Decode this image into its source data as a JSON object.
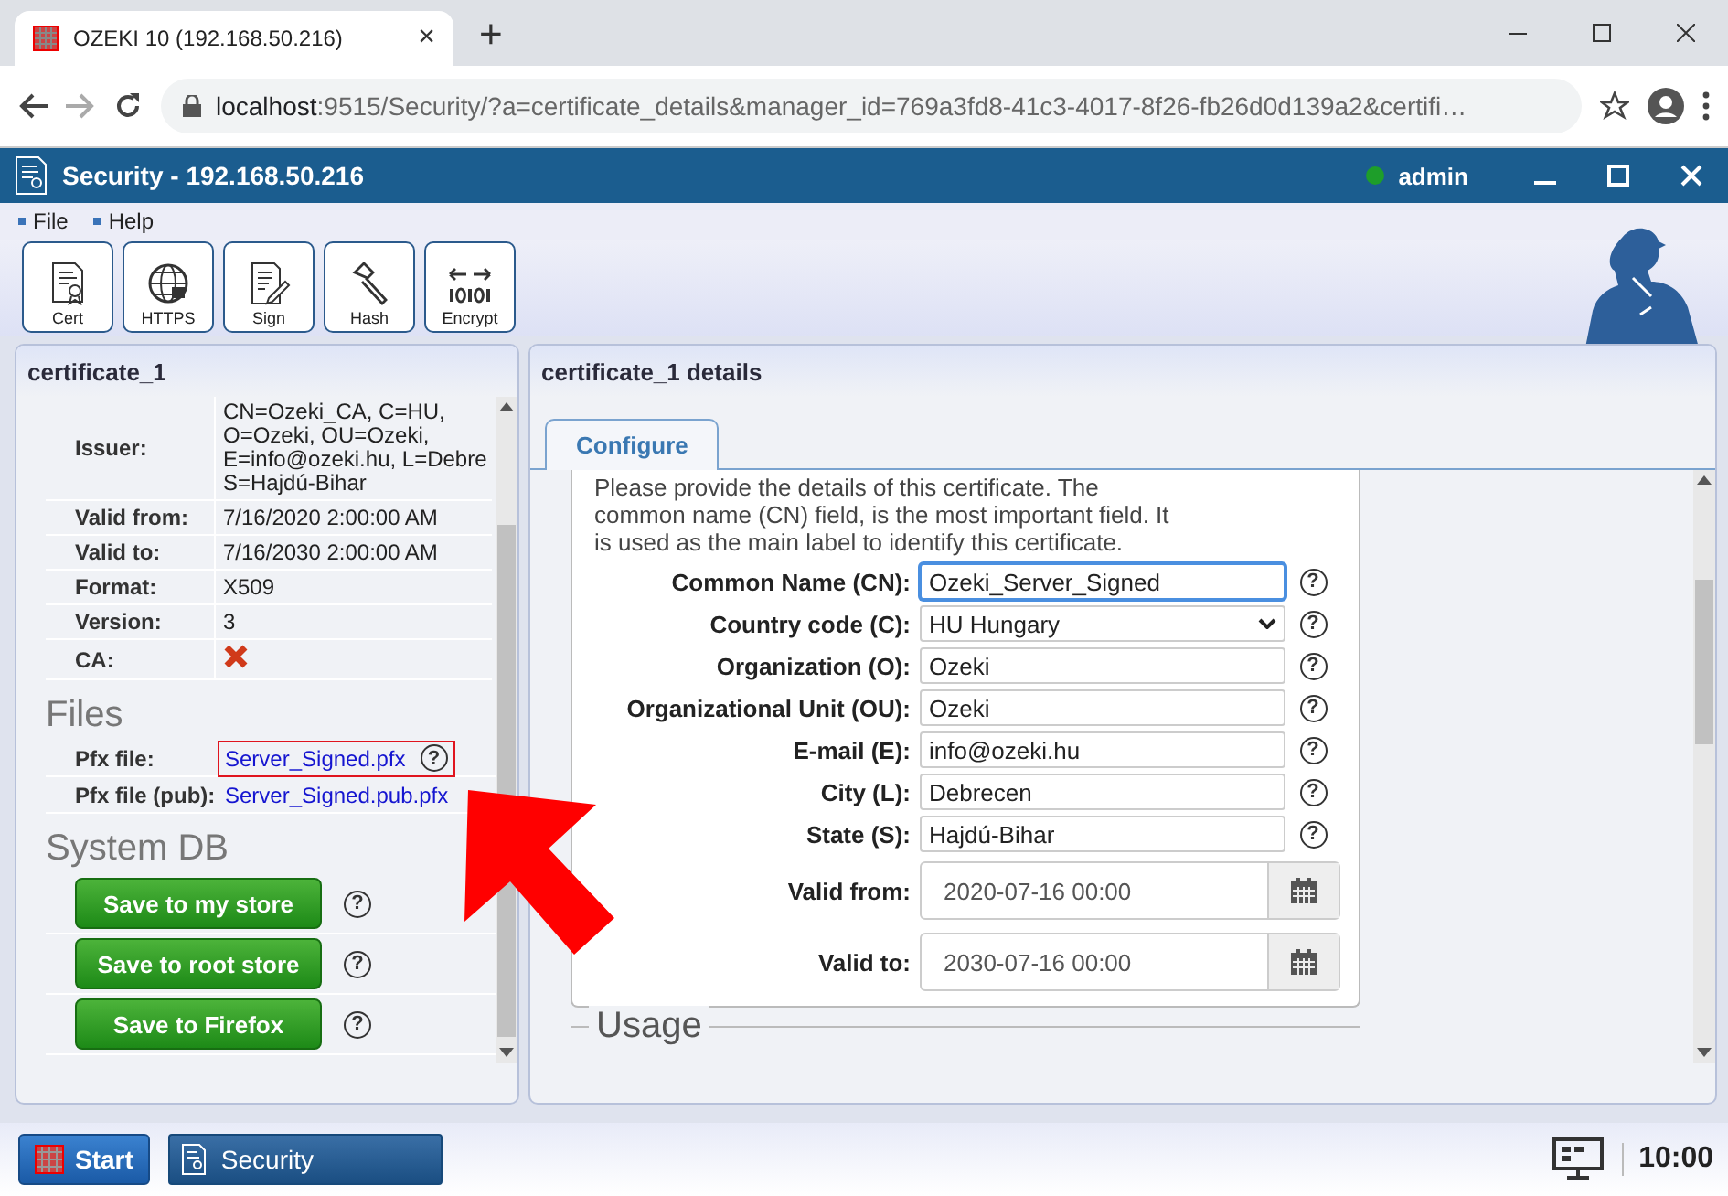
{
  "browser": {
    "tab_title": "OZEKI 10 (192.168.50.216)",
    "tab_close": "×",
    "new_tab": "+",
    "url_host": "localhost",
    "url_rest": ":9515/Security/?a=certificate_details&manager_id=769a3fd8-41c3-4017-8f26-fb26d0d139a2&certifi…"
  },
  "app": {
    "title": "Security - 192.168.50.216",
    "user": "admin",
    "online": true
  },
  "menu": [
    "File",
    "Help"
  ],
  "toolbar": [
    {
      "label": "Cert",
      "kind": "cert"
    },
    {
      "label": "HTTPS",
      "kind": "https"
    },
    {
      "label": "Sign",
      "kind": "sign"
    },
    {
      "label": "Hash",
      "kind": "hash"
    },
    {
      "label": "Encrypt",
      "kind": "encrypt"
    }
  ],
  "left_panel": {
    "title": "certificate_1",
    "properties": [
      {
        "label": "Issuer:",
        "kind": "text",
        "lines": [
          "CN=Ozeki_CA, C=HU,",
          "O=Ozeki, OU=Ozeki,",
          "E=info@ozeki.hu, L=Debre",
          "S=Hajdú-Bihar"
        ]
      },
      {
        "label": "Valid from:",
        "kind": "text",
        "lines": [
          "7/16/2020 2:00:00 AM"
        ]
      },
      {
        "label": "Valid to:",
        "kind": "text",
        "lines": [
          "7/16/2030 2:00:00 AM"
        ]
      },
      {
        "label": "Format:",
        "kind": "text",
        "lines": [
          "X509"
        ]
      },
      {
        "label": "Version:",
        "kind": "text",
        "lines": [
          "3"
        ]
      },
      {
        "label": "CA:",
        "kind": "cross"
      }
    ],
    "files_heading": "Files",
    "files": [
      {
        "label": "Pfx file:",
        "link": "Server_Signed.pfx",
        "help": "?",
        "highlighted": true
      },
      {
        "label": "Pfx file (pub):",
        "link": "Server_Signed.pub.pfx",
        "highlighted": false
      }
    ],
    "system_heading": "System DB",
    "system_buttons": [
      {
        "label": "Save to my store",
        "help": "?"
      },
      {
        "label": "Save to root store",
        "help": "?"
      },
      {
        "label": "Save to Firefox",
        "help": "?"
      }
    ]
  },
  "right_panel": {
    "title": "certificate_1 details",
    "tabs": [
      {
        "label": "Configure",
        "selected": true
      }
    ],
    "description": "Please provide the details of this certificate. The common name (CN) field, is the most important field. It is used as the main label to identify this certificate.",
    "fields": [
      {
        "label": "Common Name (CN):",
        "kind": "text",
        "value": "Ozeki_Server_Signed",
        "help": "?",
        "focused": true
      },
      {
        "label": "Country code (C):",
        "kind": "select",
        "value": "HU Hungary",
        "help": "?",
        "focused": false
      },
      {
        "label": "Organization (O):",
        "kind": "text",
        "value": "Ozeki",
        "help": "?",
        "focused": false
      },
      {
        "label": "Organizational Unit (OU):",
        "kind": "text",
        "value": "Ozeki",
        "help": "?",
        "focused": false
      },
      {
        "label": "E-mail (E):",
        "kind": "text",
        "value": "info@ozeki.hu",
        "help": "?",
        "focused": false
      },
      {
        "label": "City (L):",
        "kind": "text",
        "value": "Debrecen",
        "help": "?",
        "focused": false
      },
      {
        "label": "State (S):",
        "kind": "text",
        "value": "Hajdú-Bihar",
        "help": "?",
        "focused": false
      },
      {
        "label": "Valid from:",
        "kind": "date",
        "value": "2020-07-16 00:00"
      },
      {
        "label": "Valid to:",
        "kind": "date",
        "value": "2030-07-16 00:00"
      }
    ],
    "next_section": "Usage"
  },
  "taskbar": {
    "start": "Start",
    "apps": [
      {
        "label": "Security",
        "selected": true
      }
    ],
    "clock": "10:00"
  }
}
